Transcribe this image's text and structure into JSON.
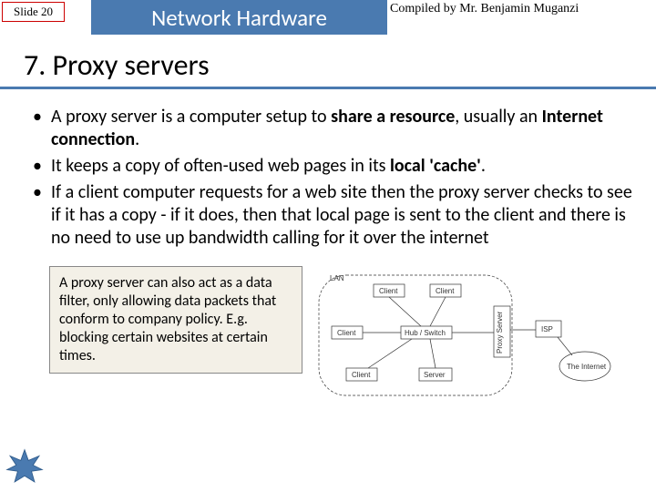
{
  "header": {
    "slide_label": "Slide 20",
    "title": "Network Hardware",
    "compiled_by": "Compiled by Mr. Benjamin Muganzi"
  },
  "subtitle": "7. Proxy servers",
  "bullets": [
    {
      "pre": "A proxy server is a computer setup to ",
      "b1": "share a resource",
      "mid": ", usually an ",
      "b2": "Internet connection",
      "post": "."
    },
    {
      "pre": "It keeps a copy of often-used web pages in its ",
      "b1": "local 'cache'",
      "mid": "",
      "b2": "",
      "post": "."
    },
    {
      "pre": "If a client computer requests for a web site then the proxy server checks to see if it has a copy - if it does, then that local page is sent to the client and there is no need to use up bandwidth calling for it over the internet",
      "b1": "",
      "mid": "",
      "b2": "",
      "post": ""
    }
  ],
  "callout": "A proxy server can also act as a data filter, only allowing data packets that conform to company policy. E.g. blocking certain websites at certain times.",
  "diagram": {
    "lan": "LAN",
    "client": "Client",
    "hub": "Hub / Switch",
    "server": "Server",
    "proxy": "Proxy Server",
    "isp": "ISP",
    "internet": "The Internet"
  }
}
